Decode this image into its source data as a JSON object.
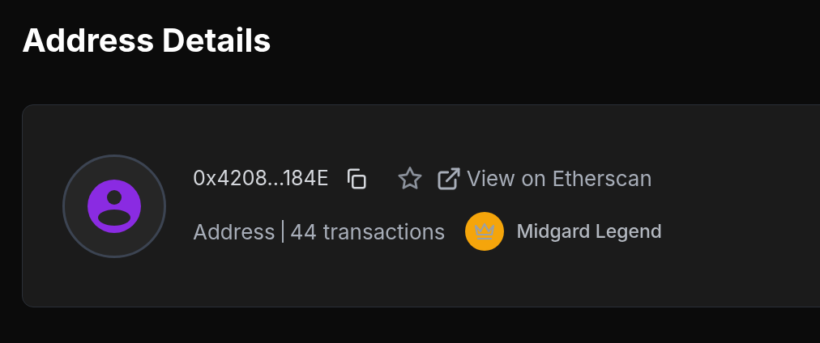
{
  "title": "Address Details",
  "address": {
    "short": "0x4208...184E",
    "starred": false,
    "explorer_link": "View on Etherscan",
    "type": "Address",
    "transactions": "44 transactions",
    "badge": {
      "label": "Midgard Legend",
      "color": "#f5a50b"
    }
  }
}
